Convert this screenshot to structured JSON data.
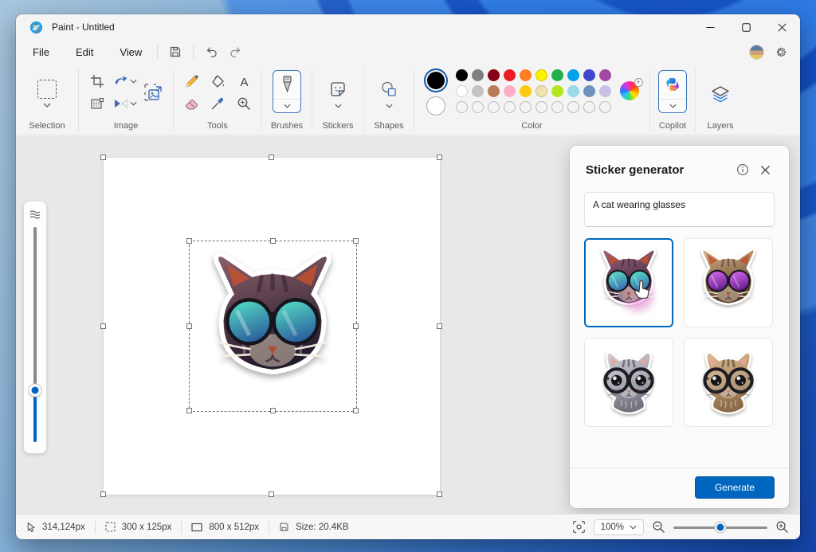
{
  "window": {
    "title": "Paint - Untitled"
  },
  "menu": {
    "items": [
      "File",
      "Edit",
      "View"
    ]
  },
  "ribbon": {
    "group_labels": {
      "selection": "Selection",
      "image": "Image",
      "tools": "Tools",
      "brushes": "Brushes",
      "stickers": "Stickers",
      "shapes": "Shapes",
      "color": "Color",
      "copilot": "Copilot",
      "layers": "Layers"
    },
    "palette": {
      "foreground": "#000000",
      "background": "#ffffff",
      "row1": [
        "#000000",
        "#7f7f7f",
        "#880015",
        "#ed1c24",
        "#ff7f27",
        "#fff200",
        "#22b14c",
        "#00a2e8",
        "#3f48cc",
        "#a349a4"
      ],
      "row2": [
        "#ffffff",
        "#c3c3c3",
        "#b97a57",
        "#ffaec9",
        "#ffc90e",
        "#efe4b0",
        "#b5e61d",
        "#99d9ea",
        "#7092be",
        "#c8bfe7"
      ],
      "empty_slots": 10
    }
  },
  "canvas": {
    "sticker": {
      "name": "cat-with-round-sunglasses",
      "style": "painterly",
      "fur_top": "#8a5f6b",
      "fur_bottom": "#241a2c",
      "lens_top": "#56e2c6",
      "lens_bottom": "#2c5f9e",
      "accent": "none"
    }
  },
  "sticker_panel": {
    "title": "Sticker generator",
    "prompt": "A cat wearing glasses",
    "generate_label": "Generate",
    "thumbnails": [
      {
        "name": "cat-teal-sunglasses",
        "selected": true,
        "style": "painterly",
        "fur_top": "#9c6478",
        "fur_bottom": "#31203a",
        "lens_top": "#5ce6c8",
        "lens_bottom": "#3a6fb0",
        "accent": "#ef8ad8"
      },
      {
        "name": "cat-purple-aviators",
        "selected": false,
        "style": "painterly",
        "fur_top": "#d9b489",
        "fur_bottom": "#533722",
        "lens_top": "#d86cf2",
        "lens_bottom": "#6a2190",
        "accent": "none"
      },
      {
        "name": "gray-cat-black-glasses",
        "selected": false,
        "style": "cartoon",
        "fur_top": "#d5d4dc",
        "fur_bottom": "#73727e",
        "lens_top": "#2a2a30",
        "lens_bottom": "#121216",
        "accent": "none"
      },
      {
        "name": "tabby-kitten-black-glasses",
        "selected": false,
        "style": "cartoon",
        "fur_top": "#e0c096",
        "fur_bottom": "#8d6b46",
        "lens_top": "#2a2a30",
        "lens_bottom": "#121216",
        "accent": "none"
      }
    ]
  },
  "status_bar": {
    "cursor_position": "314,124px",
    "selection_size": "300 x 125px",
    "canvas_size": "800 x 512px",
    "file_size": "Size: 20.4KB",
    "zoom_level": "100%"
  },
  "theme": {
    "accent": "#0067c0"
  }
}
